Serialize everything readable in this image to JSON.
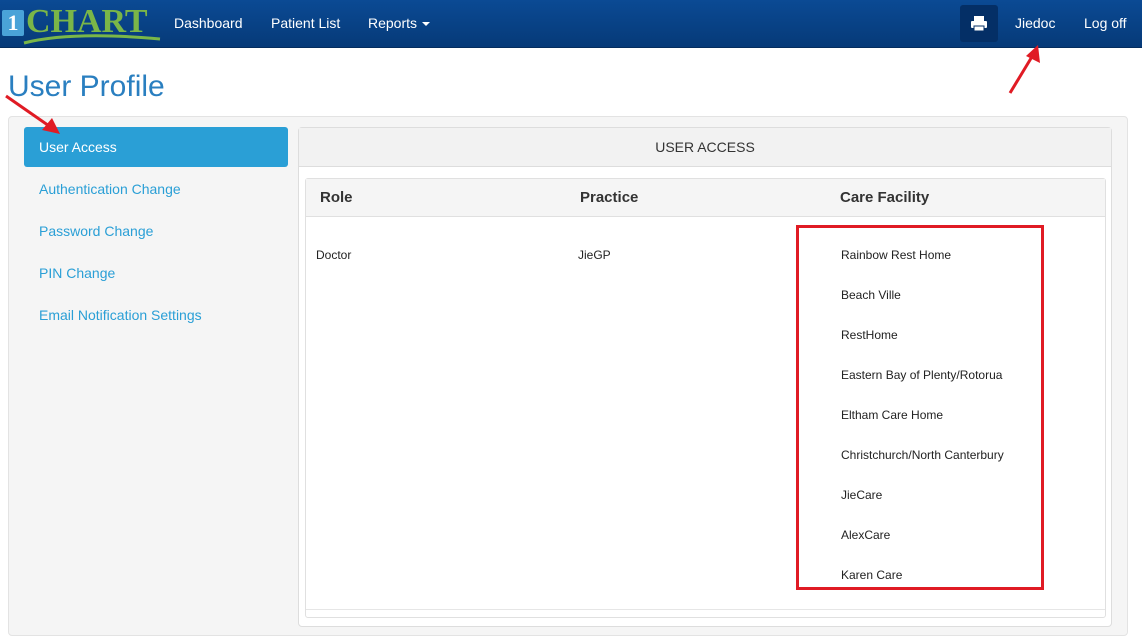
{
  "navbar": {
    "logo_text": "CHART",
    "logo_number": "1",
    "items": [
      {
        "label": "Dashboard"
      },
      {
        "label": "Patient List"
      },
      {
        "label": "Reports"
      }
    ],
    "print_icon": "printer-icon",
    "user": "Jiedoc",
    "logoff": "Log off"
  },
  "page_title": "User Profile",
  "sidebar": {
    "items": [
      {
        "label": "User Access",
        "active": true
      },
      {
        "label": "Authentication Change"
      },
      {
        "label": "Password Change"
      },
      {
        "label": "PIN Change"
      },
      {
        "label": "Email Notification Settings"
      }
    ]
  },
  "panel": {
    "heading": "USER ACCESS",
    "columns": [
      "Role",
      "Practice",
      "Care Facility"
    ],
    "row": {
      "role": "Doctor",
      "practice": "JieGP",
      "facilities": [
        "Rainbow Rest Home",
        "Beach Ville",
        "RestHome",
        "Eastern Bay of Plenty/Rotorua",
        "Eltham Care Home",
        "Christchurch/North Canterbury",
        "JieCare",
        "AlexCare",
        "Karen Care"
      ]
    }
  },
  "colors": {
    "navbar": "#0b4a94",
    "accent": "#2a9fd6",
    "annotation": "#e01b24"
  }
}
